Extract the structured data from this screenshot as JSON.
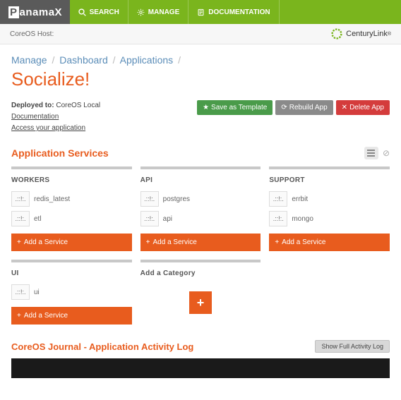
{
  "topbar": {
    "logo": "Panamax",
    "nav": [
      {
        "label": "SEARCH",
        "icon": "search"
      },
      {
        "label": "MANAGE",
        "icon": "gear"
      },
      {
        "label": "DOCUMENTATION",
        "icon": "doc"
      }
    ]
  },
  "subbar": {
    "host_label": "CoreOS Host:",
    "company": "CenturyLink"
  },
  "breadcrumb": [
    "Manage",
    "Dashboard",
    "Applications"
  ],
  "page_title": "Socialize!",
  "meta": {
    "deployed_label": "Deployed to:",
    "deployed_value": "CoreOS Local",
    "links": [
      "Documentation",
      "Access your application"
    ]
  },
  "actions": {
    "save": "Save as Template",
    "rebuild": "Rebuild App",
    "delete": "Delete App"
  },
  "services": {
    "title": "Application Services",
    "add_label": "Add a Service",
    "add_category_label": "Add a Category",
    "columns": [
      {
        "title": "WORKERS",
        "items": [
          "redis_latest",
          "etl"
        ]
      },
      {
        "title": "API",
        "items": [
          "postgres",
          "api"
        ]
      },
      {
        "title": "SUPPORT",
        "items": [
          "errbit",
          "mongo"
        ]
      },
      {
        "title": "UI",
        "items": [
          "ui"
        ]
      }
    ]
  },
  "journal": {
    "title": "CoreOS Journal - Application Activity Log",
    "button": "Show Full Activity Log"
  }
}
